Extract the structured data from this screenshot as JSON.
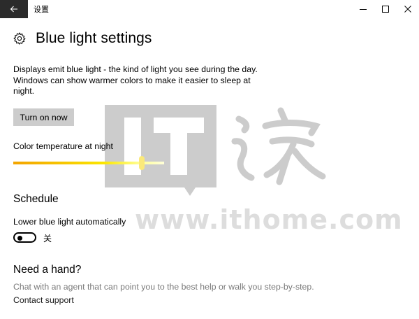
{
  "titlebar": {
    "app_title": "设置",
    "back_icon": "arrow-left-icon",
    "minimize_icon": "minimize-icon",
    "maximize_icon": "maximize-icon",
    "close_icon": "close-icon"
  },
  "header": {
    "icon": "gear-icon",
    "title": "Blue light settings"
  },
  "description": "Displays emit blue light - the kind of light you see during the day. Windows can show warmer colors to make it easier to sleep at night.",
  "turn_on_button": "Turn on now",
  "color_temperature": {
    "label": "Color temperature at night",
    "level": 0.85
  },
  "schedule": {
    "title": "Schedule",
    "auto_label": "Lower blue light automatically",
    "toggle_on": false,
    "toggle_state": "关"
  },
  "help": {
    "title": "Need a hand?",
    "description": "Chat with an agent that can point you to the best help or walk you step-by-step.",
    "contact_link": "Contact support"
  },
  "watermark": {
    "logo_text": "IT",
    "site": "www.ithome.com"
  },
  "colors": {
    "back_button_bg": "#2b2b2b",
    "button_bg": "#cccccc",
    "slider_start": "#f3a400",
    "slider_end": "#ffffd8",
    "secondary_text": "#7a7a7a"
  }
}
